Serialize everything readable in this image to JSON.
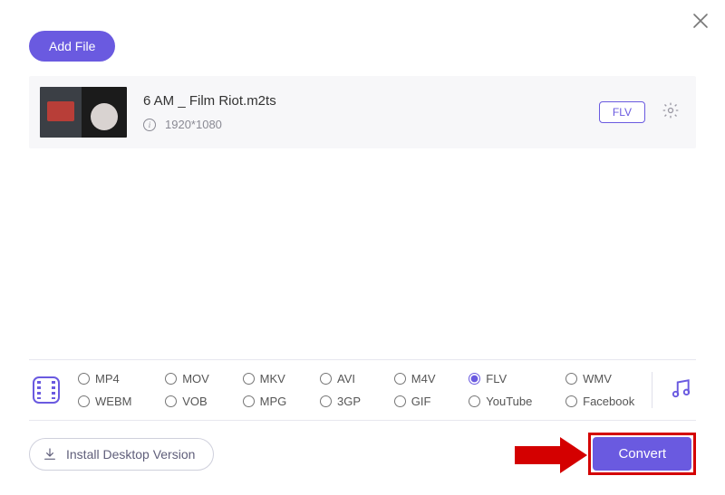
{
  "buttons": {
    "add_file": "Add File",
    "install": "Install Desktop Version",
    "convert": "Convert"
  },
  "file": {
    "name": "6 AM _ Film Riot.m2ts",
    "resolution": "1920*1080",
    "out_format": "FLV"
  },
  "formats": {
    "row1": [
      "MP4",
      "MOV",
      "MKV",
      "AVI",
      "M4V",
      "FLV",
      "WMV"
    ],
    "row2": [
      "WEBM",
      "VOB",
      "MPG",
      "3GP",
      "GIF",
      "YouTube",
      "Facebook"
    ],
    "selected": "FLV"
  }
}
